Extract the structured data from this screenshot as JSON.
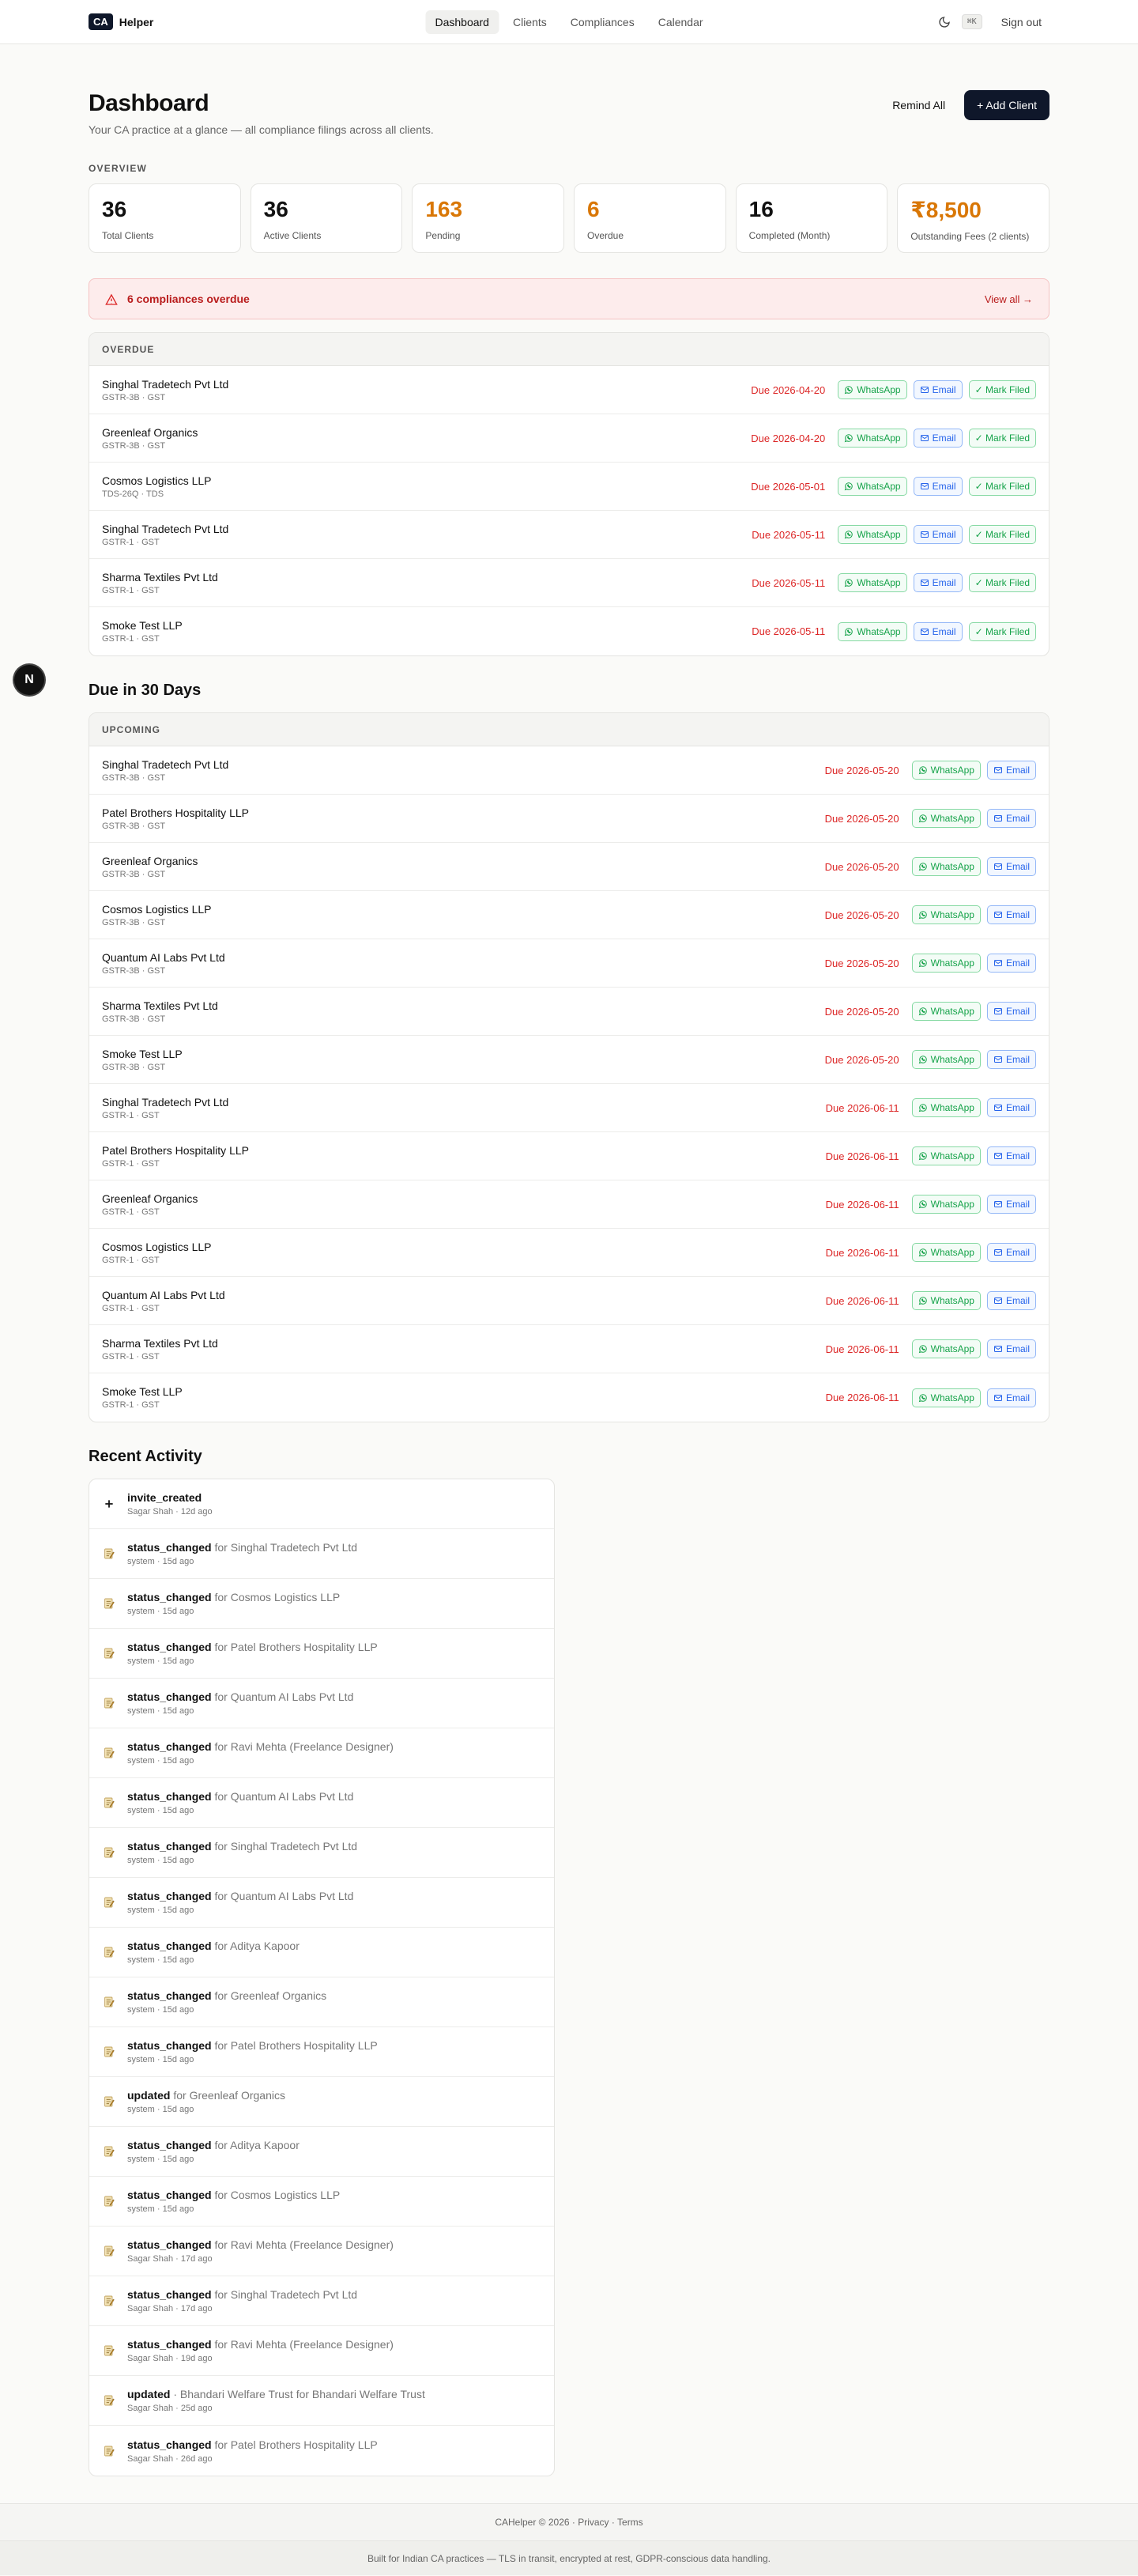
{
  "brand": {
    "logo": "CA",
    "name": "Helper"
  },
  "nav": {
    "links": [
      "Dashboard",
      "Clients",
      "Compliances",
      "Calendar"
    ],
    "kbd": "⌘K",
    "signout": "Sign out"
  },
  "header": {
    "title": "Dashboard",
    "subtitle": "Your CA practice at a glance — all compliance filings across all clients.",
    "remind_all": "Remind All",
    "add_client": "+ Add Client"
  },
  "overview": {
    "label": "OVERVIEW",
    "stats": [
      {
        "value": "36",
        "label": "Total Clients"
      },
      {
        "value": "36",
        "label": "Active Clients"
      },
      {
        "value": "163",
        "label": "Pending"
      },
      {
        "value": "6",
        "label": "Overdue"
      },
      {
        "value": "16",
        "label": "Completed (Month)"
      },
      {
        "value": "₹8,500",
        "label": "Outstanding Fees (2 clients)"
      }
    ]
  },
  "alert": {
    "text": "6 compliances overdue",
    "link": "View all →"
  },
  "overdue": {
    "head": "OVERDUE",
    "rows": [
      {
        "name": "Singhal Tradetech Pvt Ltd",
        "meta": "GSTR-3B · GST",
        "due": "Due 2026-04-20"
      },
      {
        "name": "Greenleaf Organics",
        "meta": "GSTR-3B · GST",
        "due": "Due 2026-04-20"
      },
      {
        "name": "Cosmos Logistics LLP",
        "meta": "TDS-26Q · TDS",
        "due": "Due 2026-05-01"
      },
      {
        "name": "Singhal Tradetech Pvt Ltd",
        "meta": "GSTR-1 · GST",
        "due": "Due 2026-05-11"
      },
      {
        "name": "Sharma Textiles Pvt Ltd",
        "meta": "GSTR-1 · GST",
        "due": "Due 2026-05-11"
      },
      {
        "name": "Smoke Test LLP",
        "meta": "GSTR-1 · GST",
        "due": "Due 2026-05-11"
      }
    ]
  },
  "chips": {
    "whatsapp": "WhatsApp",
    "email": "Email",
    "mark_filed": "✓ Mark Filed"
  },
  "upcoming": {
    "title": "Due in 30 Days",
    "head": "UPCOMING",
    "rows": [
      {
        "name": "Singhal Tradetech Pvt Ltd",
        "meta": "GSTR-3B · GST",
        "due": "Due 2026-05-20"
      },
      {
        "name": "Patel Brothers Hospitality LLP",
        "meta": "GSTR-3B · GST",
        "due": "Due 2026-05-20"
      },
      {
        "name": "Greenleaf Organics",
        "meta": "GSTR-3B · GST",
        "due": "Due 2026-05-20"
      },
      {
        "name": "Cosmos Logistics LLP",
        "meta": "GSTR-3B · GST",
        "due": "Due 2026-05-20"
      },
      {
        "name": "Quantum AI Labs Pvt Ltd",
        "meta": "GSTR-3B · GST",
        "due": "Due 2026-05-20"
      },
      {
        "name": "Sharma Textiles Pvt Ltd",
        "meta": "GSTR-3B · GST",
        "due": "Due 2026-05-20"
      },
      {
        "name": "Smoke Test LLP",
        "meta": "GSTR-3B · GST",
        "due": "Due 2026-05-20"
      },
      {
        "name": "Singhal Tradetech Pvt Ltd",
        "meta": "GSTR-1 · GST",
        "due": "Due 2026-06-11"
      },
      {
        "name": "Patel Brothers Hospitality LLP",
        "meta": "GSTR-1 · GST",
        "due": "Due 2026-06-11"
      },
      {
        "name": "Greenleaf Organics",
        "meta": "GSTR-1 · GST",
        "due": "Due 2026-06-11"
      },
      {
        "name": "Cosmos Logistics LLP",
        "meta": "GSTR-1 · GST",
        "due": "Due 2026-06-11"
      },
      {
        "name": "Quantum AI Labs Pvt Ltd",
        "meta": "GSTR-1 · GST",
        "due": "Due 2026-06-11"
      },
      {
        "name": "Sharma Textiles Pvt Ltd",
        "meta": "GSTR-1 · GST",
        "due": "Due 2026-06-11"
      },
      {
        "name": "Smoke Test LLP",
        "meta": "GSTR-1 · GST",
        "due": "Due 2026-06-11"
      }
    ]
  },
  "activity": {
    "title": "Recent Activity",
    "rows": [
      {
        "icon": "plus-icon",
        "action": "invite_created",
        "for": "",
        "meta": "Sagar Shah · 12d ago"
      },
      {
        "icon": "memo-icon",
        "action": "status_changed",
        "for": " for Singhal Tradetech Pvt Ltd",
        "meta": "system · 15d ago"
      },
      {
        "icon": "memo-icon",
        "action": "status_changed",
        "for": " for Cosmos Logistics LLP",
        "meta": "system · 15d ago"
      },
      {
        "icon": "memo-icon",
        "action": "status_changed",
        "for": " for Patel Brothers Hospitality LLP",
        "meta": "system · 15d ago"
      },
      {
        "icon": "memo-icon",
        "action": "status_changed",
        "for": " for Quantum AI Labs Pvt Ltd",
        "meta": "system · 15d ago"
      },
      {
        "icon": "memo-icon",
        "action": "status_changed",
        "for": " for Ravi Mehta (Freelance Designer)",
        "meta": "system · 15d ago"
      },
      {
        "icon": "memo-icon",
        "action": "status_changed",
        "for": " for Quantum AI Labs Pvt Ltd",
        "meta": "system · 15d ago"
      },
      {
        "icon": "memo-icon",
        "action": "status_changed",
        "for": " for Singhal Tradetech Pvt Ltd",
        "meta": "system · 15d ago"
      },
      {
        "icon": "memo-icon",
        "action": "status_changed",
        "for": " for Quantum AI Labs Pvt Ltd",
        "meta": "system · 15d ago"
      },
      {
        "icon": "memo-icon",
        "action": "status_changed",
        "for": " for Aditya Kapoor",
        "meta": "system · 15d ago"
      },
      {
        "icon": "memo-icon",
        "action": "status_changed",
        "for": " for Greenleaf Organics",
        "meta": "system · 15d ago"
      },
      {
        "icon": "memo-icon",
        "action": "status_changed",
        "for": " for Patel Brothers Hospitality LLP",
        "meta": "system · 15d ago"
      },
      {
        "icon": "memo-icon",
        "action": "updated",
        "for": " for Greenleaf Organics",
        "meta": "system · 15d ago"
      },
      {
        "icon": "memo-icon",
        "action": "status_changed",
        "for": " for Aditya Kapoor",
        "meta": "system · 15d ago"
      },
      {
        "icon": "memo-icon",
        "action": "status_changed",
        "for": " for Cosmos Logistics LLP",
        "meta": "system · 15d ago"
      },
      {
        "icon": "memo-icon",
        "action": "status_changed",
        "for": " for Ravi Mehta (Freelance Designer)",
        "meta": "Sagar Shah · 17d ago"
      },
      {
        "icon": "memo-icon",
        "action": "status_changed",
        "for": " for Singhal Tradetech Pvt Ltd",
        "meta": "Sagar Shah · 17d ago"
      },
      {
        "icon": "memo-icon",
        "action": "status_changed",
        "for": " for Ravi Mehta (Freelance Designer)",
        "meta": "Sagar Shah · 19d ago"
      },
      {
        "icon": "memo-icon",
        "action": "updated",
        "for": " · Bhandari Welfare Trust for Bhandari Welfare Trust",
        "meta": "Sagar Shah · 25d ago"
      },
      {
        "icon": "memo-icon",
        "action": "status_changed",
        "for": " for Patel Brothers Hospitality LLP",
        "meta": "Sagar Shah · 26d ago"
      }
    ]
  },
  "footer": {
    "copyright": "CAHelper © 2026",
    "privacy": "Privacy",
    "terms": "Terms",
    "note": "Built for Indian CA practices — TLS in transit, encrypted at rest, GDPR-conscious data handling."
  },
  "floating": {
    "letter": "N"
  },
  "colors": {
    "primary": "#0f172a",
    "overdue_red": "#dc2626",
    "warning_orange": "#d97706",
    "whatsapp_green": "#16a34a",
    "email_blue": "#2563eb"
  }
}
